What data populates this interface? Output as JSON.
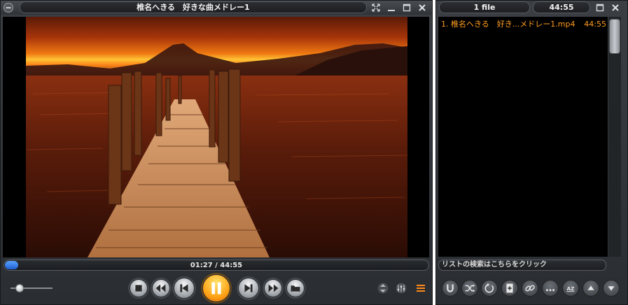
{
  "player": {
    "title": "椎名へきる　好きな曲メドレー1",
    "time": "01:27 / 44:55",
    "progress": 0.032,
    "volume": 0.12
  },
  "playlist": {
    "file_count": "1 file",
    "total_time": "44:55",
    "items": [
      {
        "name": "1. 椎名へきる　好き...メドレー1.mp4",
        "duration": "44:55"
      }
    ],
    "search_placeholder": "リストの検索はこちらをクリック"
  },
  "colors": {
    "accent_orange": "#ff9c1f",
    "seek_blue": "#2f74e6",
    "chrome_dark": "#2d3034"
  },
  "icons": {
    "menu": "minus-icon",
    "fullscreen": "expand-arrows-icon",
    "minimize": "minimize-icon",
    "maximize": "maximize-icon",
    "close": "close-icon"
  }
}
